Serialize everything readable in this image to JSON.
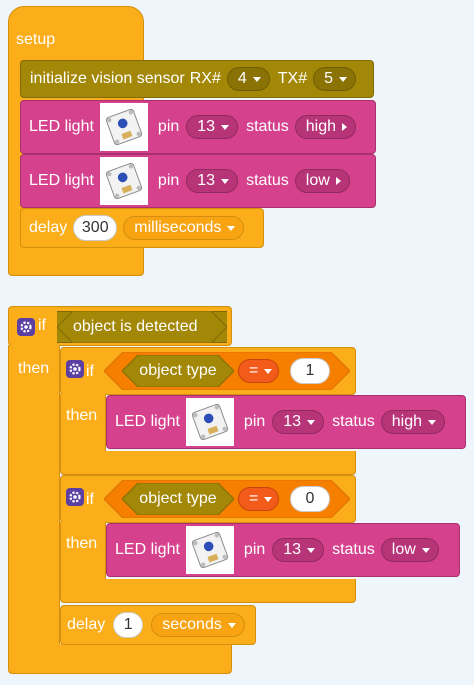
{
  "setup": {
    "hat_label": "setup",
    "init": {
      "label": "initialize vision sensor",
      "rx_label": "RX#",
      "rx_value": "4",
      "tx_label": "TX#",
      "tx_value": "5"
    },
    "led1": {
      "label": "LED light",
      "pin_label": "pin",
      "pin": "13",
      "status_label": "status",
      "status": "high"
    },
    "led2": {
      "label": "LED light",
      "pin_label": "pin",
      "pin": "13",
      "status_label": "status",
      "status": "low"
    },
    "delay": {
      "label": "delay",
      "value": "300",
      "unit": "milliseconds"
    }
  },
  "main_if": {
    "if_label": "if",
    "condition": "object is detected",
    "then_label": "then",
    "inner_if1": {
      "if_label": "if",
      "lhs": "object type",
      "op": "=",
      "rhs": "1",
      "then_label": "then",
      "led": {
        "label": "LED light",
        "pin_label": "pin",
        "pin": "13",
        "status_label": "status",
        "status": "high"
      }
    },
    "inner_if2": {
      "if_label": "if",
      "lhs": "object type",
      "op": "=",
      "rhs": "0",
      "then_label": "then",
      "led": {
        "label": "LED light",
        "pin_label": "pin",
        "pin": "13",
        "status_label": "status",
        "status": "low"
      }
    },
    "delay": {
      "label": "delay",
      "value": "1",
      "unit": "seconds"
    }
  },
  "colors": {
    "control": "#fbad1a",
    "sensor": "#a38807",
    "led": "#d6418e"
  },
  "icons": {
    "extension": "gear-icon",
    "dropdown": "caret-down-icon",
    "module": "led-module-image"
  }
}
